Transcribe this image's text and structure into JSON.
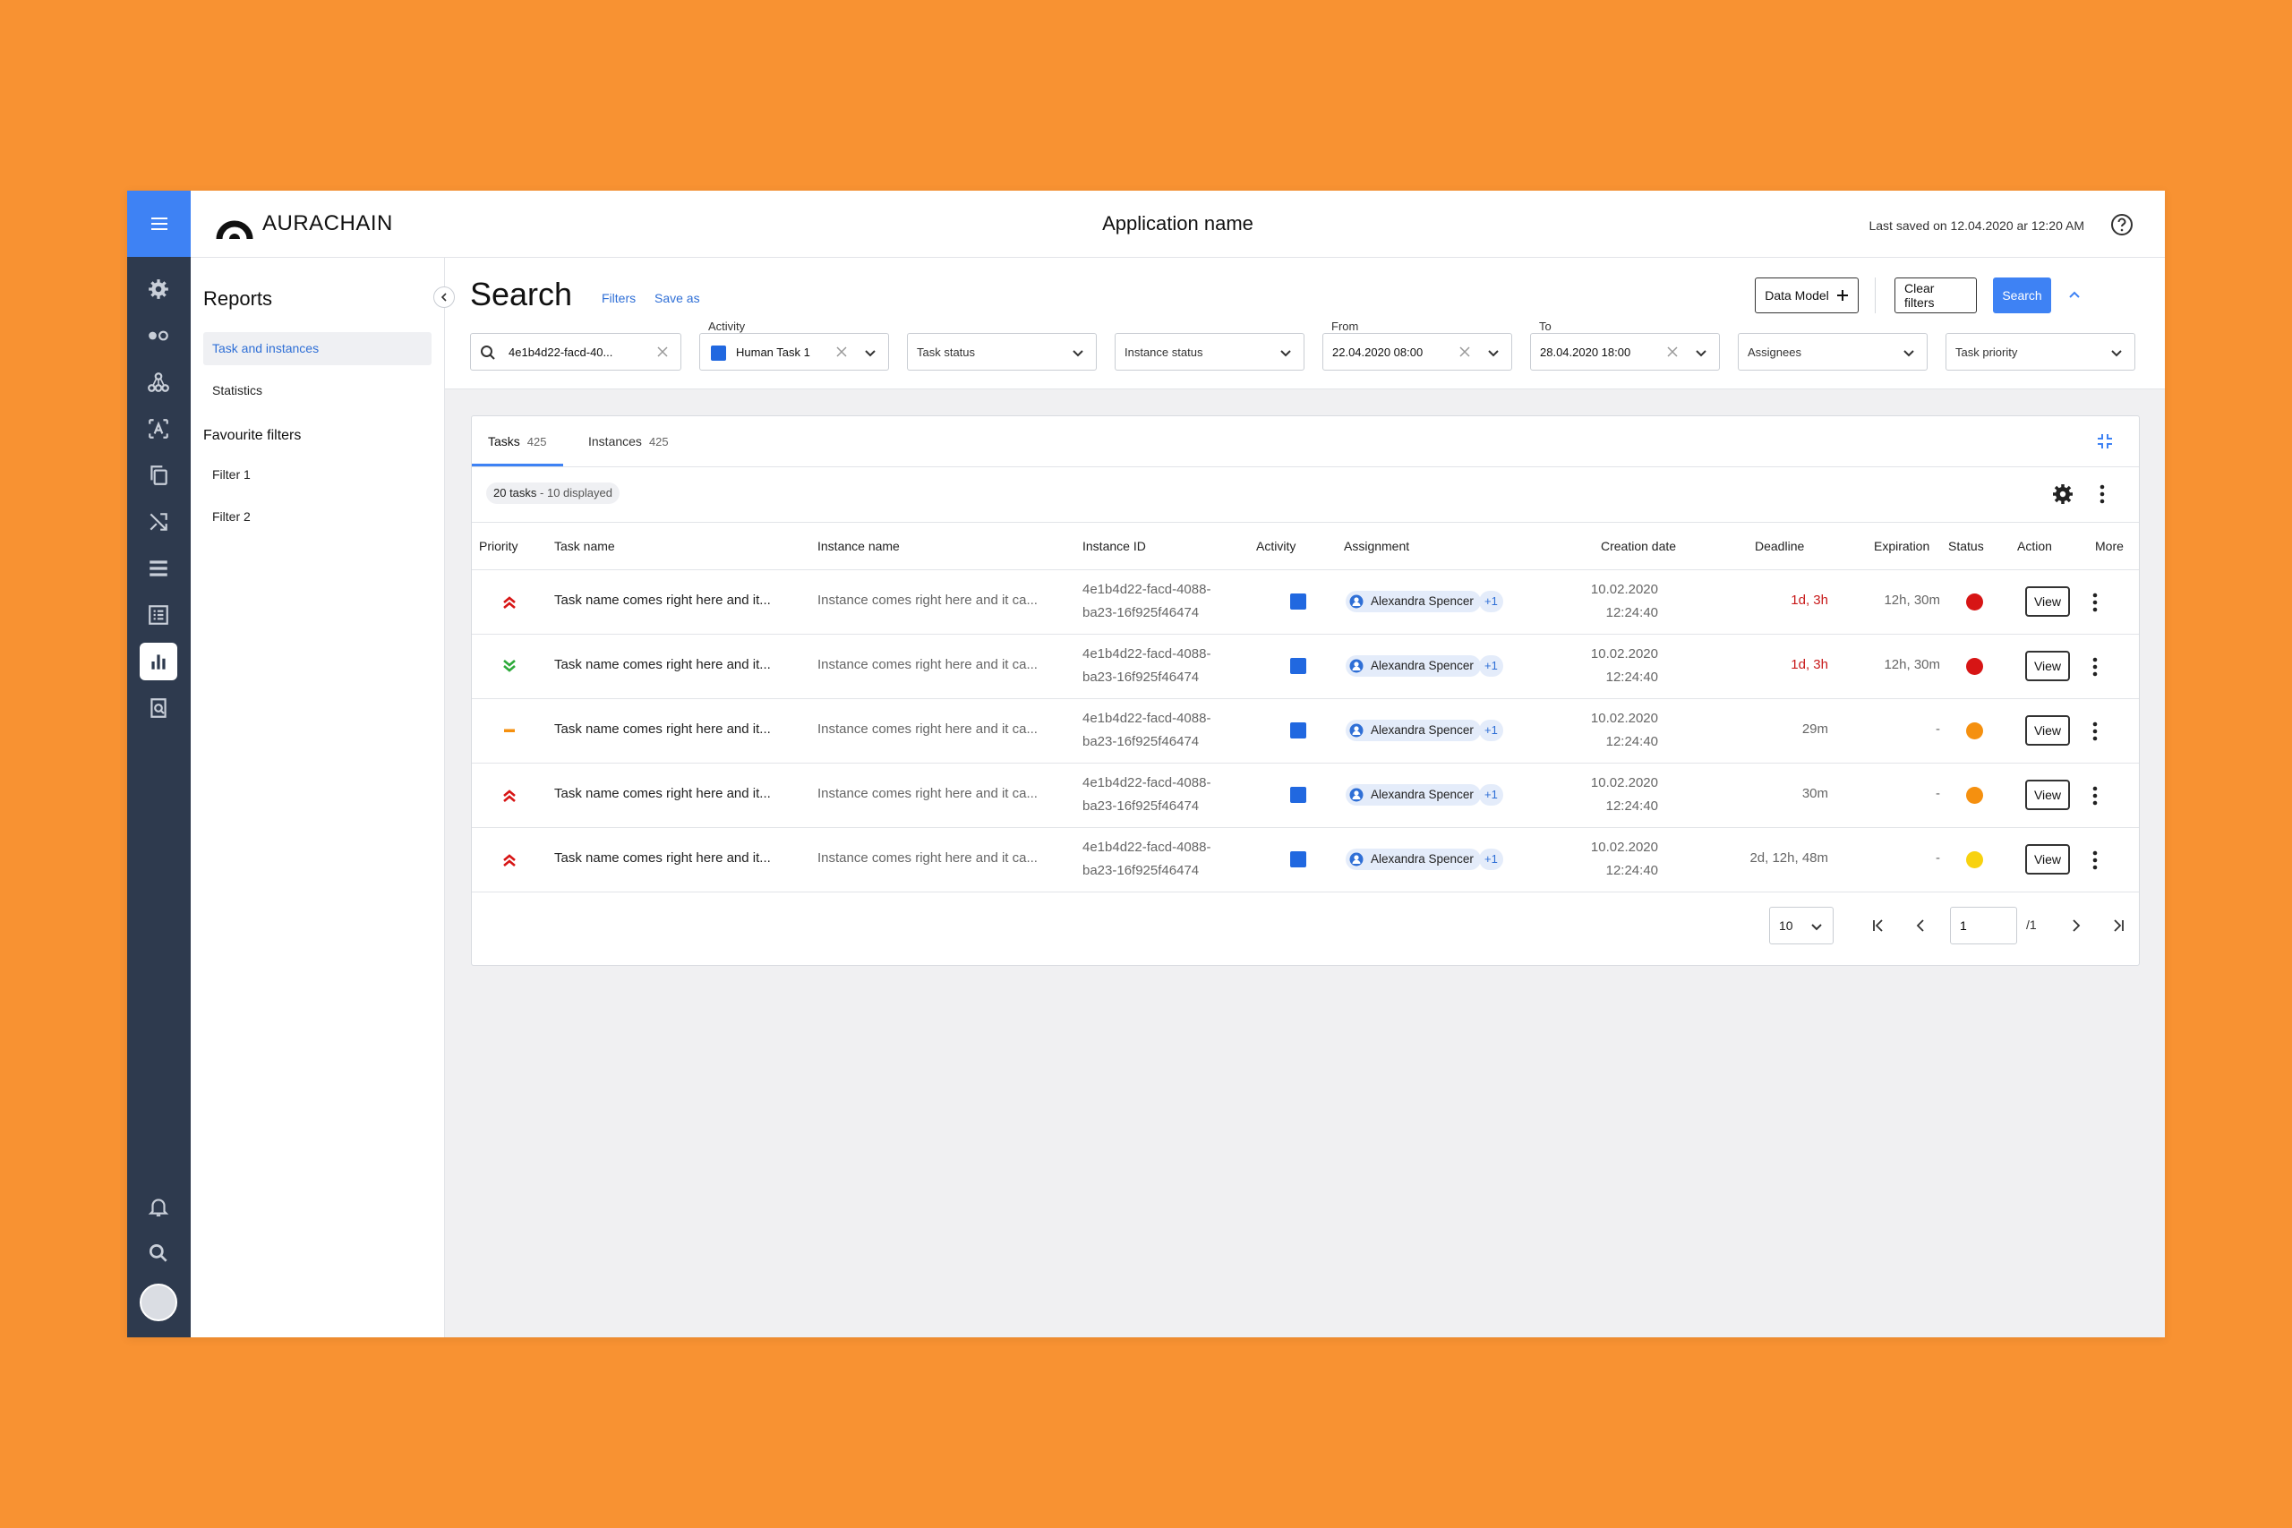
{
  "app": {
    "brand": "AURACHAIN",
    "name": "Application name",
    "last_saved": "Last saved on 12.04.2020 ar 12:20 AM"
  },
  "rail": {
    "icons": [
      "menu-icon",
      "gear-icon",
      "toggle-icon",
      "network-icon",
      "ocr-icon",
      "copy-icon",
      "shuffle-icon",
      "list-icon",
      "form-icon",
      "bar-chart-icon",
      "search-doc-icon",
      "bell-icon",
      "search-icon"
    ],
    "active": "bar-chart-icon"
  },
  "sidebar": {
    "title": "Reports",
    "items": [
      {
        "label": "Task and instances",
        "active": true
      },
      {
        "label": "Statistics",
        "active": false
      }
    ],
    "favourites_title": "Favourite filters",
    "favourites": [
      {
        "label": "Filter 1"
      },
      {
        "label": "Filter 2"
      }
    ]
  },
  "search": {
    "title": "Search",
    "filters_link": "Filters",
    "save_as_link": "Save as",
    "data_model_label": "Data Model",
    "clear_filters_label": "Clear filters",
    "search_label": "Search",
    "query": "4e1b4d22-facd-40...",
    "activity_label": "Activity",
    "activity_value": "Human Task 1",
    "task_status_placeholder": "Task status",
    "instance_status_placeholder": "Instance status",
    "from_label": "From",
    "from_value": "22.04.2020 08:00",
    "to_label": "To",
    "to_value": "28.04.2020 18:00",
    "assignees_placeholder": "Assignees",
    "task_priority_placeholder": "Task priority"
  },
  "tabs": [
    {
      "label": "Tasks",
      "count": "425",
      "active": true
    },
    {
      "label": "Instances",
      "count": "425",
      "active": false
    }
  ],
  "summary": {
    "count": "20 tasks",
    "sep": " - ",
    "displayed": "10 displayed"
  },
  "table": {
    "columns": [
      "Priority",
      "Task name",
      "Instance name",
      "Instance ID",
      "Activity",
      "Assignment",
      "Creation date",
      "Deadline",
      "Expiration",
      "Status",
      "Action",
      "More"
    ],
    "rows": [
      {
        "priority": "high",
        "task": "Task name comes right here and it...",
        "instance": "Instance comes right here and it ca...",
        "id1": "4e1b4d22-facd-4088-",
        "id2": "ba23-16f925f46474",
        "assignee": "Alexandra Spencer",
        "extra": "+1",
        "date": "10.02.2020",
        "time": "12:24:40",
        "deadline": "1d, 3h",
        "deadline_overdue": true,
        "expiration": "12h, 30m",
        "status_color": "#D71515",
        "action": "View"
      },
      {
        "priority": "low",
        "task": "Task name comes right here and it...",
        "instance": "Instance comes right here and it ca...",
        "id1": "4e1b4d22-facd-4088-",
        "id2": "ba23-16f925f46474",
        "assignee": "Alexandra Spencer",
        "extra": "+1",
        "date": "10.02.2020",
        "time": "12:24:40",
        "deadline": "1d, 3h",
        "deadline_overdue": true,
        "expiration": "12h, 30m",
        "status_color": "#D71515",
        "action": "View"
      },
      {
        "priority": "medium",
        "task": "Task name comes right here and it...",
        "instance": "Instance comes right here and it ca...",
        "id1": "4e1b4d22-facd-4088-",
        "id2": "ba23-16f925f46474",
        "assignee": "Alexandra Spencer",
        "extra": "+1",
        "date": "10.02.2020",
        "time": "12:24:40",
        "deadline": "29m",
        "deadline_overdue": false,
        "expiration": "-",
        "status_color": "#F5900F",
        "action": "View"
      },
      {
        "priority": "high",
        "task": "Task name comes right here and it...",
        "instance": "Instance comes right here and it ca...",
        "id1": "4e1b4d22-facd-4088-",
        "id2": "ba23-16f925f46474",
        "assignee": "Alexandra Spencer",
        "extra": "+1",
        "date": "10.02.2020",
        "time": "12:24:40",
        "deadline": "30m",
        "deadline_overdue": false,
        "expiration": "-",
        "status_color": "#F5900F",
        "action": "View"
      },
      {
        "priority": "high",
        "task": "Task name comes right here and it...",
        "instance": "Instance comes right here and it ca...",
        "id1": "4e1b4d22-facd-4088-",
        "id2": "ba23-16f925f46474",
        "assignee": "Alexandra Spencer",
        "extra": "+1",
        "date": "10.02.2020",
        "time": "12:24:40",
        "deadline": "2d, 12h, 48m",
        "deadline_overdue": false,
        "expiration": "-",
        "status_color": "#F8D20F",
        "action": "View"
      }
    ]
  },
  "pagination": {
    "page_size": "10",
    "current_page": "1",
    "total_pages": "/1"
  },
  "colors": {
    "accent": "#3E82F4",
    "rail": "#2E3A4E",
    "background": "#F89232",
    "overdue": "#C81919"
  }
}
